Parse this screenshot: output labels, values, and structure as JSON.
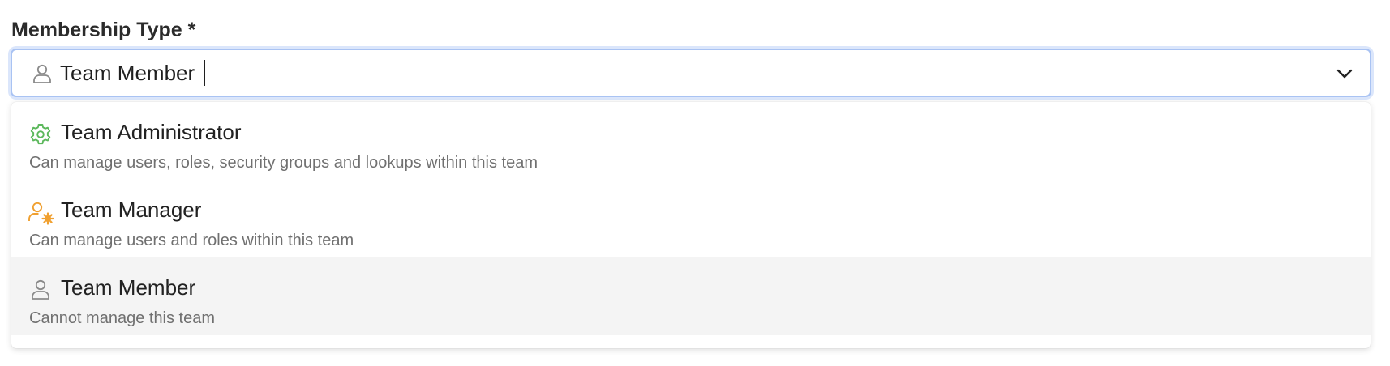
{
  "field": {
    "label": "Membership Type *",
    "value": "Team Member",
    "icon": "user-icon"
  },
  "dropdown": {
    "options": [
      {
        "title": "Team Administrator",
        "description": "Can manage users, roles, security groups and lookups within this team",
        "icon": "gear-icon",
        "icon_color": "#5cb85c"
      },
      {
        "title": "Team Manager",
        "description": "Can manage users and roles within this team",
        "icon": "user-gear-icon",
        "icon_color": "#f0a030"
      },
      {
        "title": "Team Member",
        "description": "Cannot manage this team",
        "icon": "user-icon",
        "icon_color": "#8a8a8a",
        "selected": true
      }
    ]
  },
  "colors": {
    "focus_border": "#a9c3f3",
    "selected_row": "#f4f4f4"
  }
}
